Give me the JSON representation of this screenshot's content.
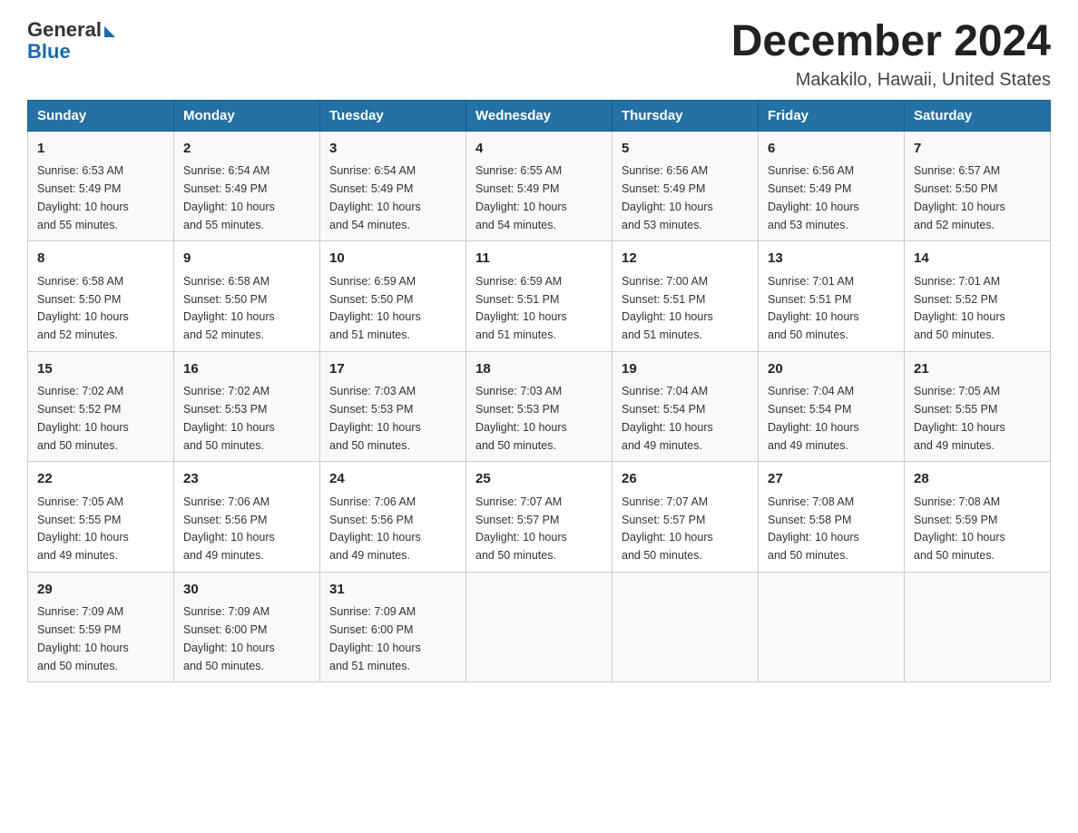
{
  "logo": {
    "general": "General",
    "blue": "Blue"
  },
  "title": "December 2024",
  "location": "Makakilo, Hawaii, United States",
  "days_of_week": [
    "Sunday",
    "Monday",
    "Tuesday",
    "Wednesday",
    "Thursday",
    "Friday",
    "Saturday"
  ],
  "weeks": [
    [
      {
        "day": "1",
        "sunrise": "6:53 AM",
        "sunset": "5:49 PM",
        "daylight": "10 hours and 55 minutes."
      },
      {
        "day": "2",
        "sunrise": "6:54 AM",
        "sunset": "5:49 PM",
        "daylight": "10 hours and 55 minutes."
      },
      {
        "day": "3",
        "sunrise": "6:54 AM",
        "sunset": "5:49 PM",
        "daylight": "10 hours and 54 minutes."
      },
      {
        "day": "4",
        "sunrise": "6:55 AM",
        "sunset": "5:49 PM",
        "daylight": "10 hours and 54 minutes."
      },
      {
        "day": "5",
        "sunrise": "6:56 AM",
        "sunset": "5:49 PM",
        "daylight": "10 hours and 53 minutes."
      },
      {
        "day": "6",
        "sunrise": "6:56 AM",
        "sunset": "5:49 PM",
        "daylight": "10 hours and 53 minutes."
      },
      {
        "day": "7",
        "sunrise": "6:57 AM",
        "sunset": "5:50 PM",
        "daylight": "10 hours and 52 minutes."
      }
    ],
    [
      {
        "day": "8",
        "sunrise": "6:58 AM",
        "sunset": "5:50 PM",
        "daylight": "10 hours and 52 minutes."
      },
      {
        "day": "9",
        "sunrise": "6:58 AM",
        "sunset": "5:50 PM",
        "daylight": "10 hours and 52 minutes."
      },
      {
        "day": "10",
        "sunrise": "6:59 AM",
        "sunset": "5:50 PM",
        "daylight": "10 hours and 51 minutes."
      },
      {
        "day": "11",
        "sunrise": "6:59 AM",
        "sunset": "5:51 PM",
        "daylight": "10 hours and 51 minutes."
      },
      {
        "day": "12",
        "sunrise": "7:00 AM",
        "sunset": "5:51 PM",
        "daylight": "10 hours and 51 minutes."
      },
      {
        "day": "13",
        "sunrise": "7:01 AM",
        "sunset": "5:51 PM",
        "daylight": "10 hours and 50 minutes."
      },
      {
        "day": "14",
        "sunrise": "7:01 AM",
        "sunset": "5:52 PM",
        "daylight": "10 hours and 50 minutes."
      }
    ],
    [
      {
        "day": "15",
        "sunrise": "7:02 AM",
        "sunset": "5:52 PM",
        "daylight": "10 hours and 50 minutes."
      },
      {
        "day": "16",
        "sunrise": "7:02 AM",
        "sunset": "5:53 PM",
        "daylight": "10 hours and 50 minutes."
      },
      {
        "day": "17",
        "sunrise": "7:03 AM",
        "sunset": "5:53 PM",
        "daylight": "10 hours and 50 minutes."
      },
      {
        "day": "18",
        "sunrise": "7:03 AM",
        "sunset": "5:53 PM",
        "daylight": "10 hours and 50 minutes."
      },
      {
        "day": "19",
        "sunrise": "7:04 AM",
        "sunset": "5:54 PM",
        "daylight": "10 hours and 49 minutes."
      },
      {
        "day": "20",
        "sunrise": "7:04 AM",
        "sunset": "5:54 PM",
        "daylight": "10 hours and 49 minutes."
      },
      {
        "day": "21",
        "sunrise": "7:05 AM",
        "sunset": "5:55 PM",
        "daylight": "10 hours and 49 minutes."
      }
    ],
    [
      {
        "day": "22",
        "sunrise": "7:05 AM",
        "sunset": "5:55 PM",
        "daylight": "10 hours and 49 minutes."
      },
      {
        "day": "23",
        "sunrise": "7:06 AM",
        "sunset": "5:56 PM",
        "daylight": "10 hours and 49 minutes."
      },
      {
        "day": "24",
        "sunrise": "7:06 AM",
        "sunset": "5:56 PM",
        "daylight": "10 hours and 49 minutes."
      },
      {
        "day": "25",
        "sunrise": "7:07 AM",
        "sunset": "5:57 PM",
        "daylight": "10 hours and 50 minutes."
      },
      {
        "day": "26",
        "sunrise": "7:07 AM",
        "sunset": "5:57 PM",
        "daylight": "10 hours and 50 minutes."
      },
      {
        "day": "27",
        "sunrise": "7:08 AM",
        "sunset": "5:58 PM",
        "daylight": "10 hours and 50 minutes."
      },
      {
        "day": "28",
        "sunrise": "7:08 AM",
        "sunset": "5:59 PM",
        "daylight": "10 hours and 50 minutes."
      }
    ],
    [
      {
        "day": "29",
        "sunrise": "7:09 AM",
        "sunset": "5:59 PM",
        "daylight": "10 hours and 50 minutes."
      },
      {
        "day": "30",
        "sunrise": "7:09 AM",
        "sunset": "6:00 PM",
        "daylight": "10 hours and 50 minutes."
      },
      {
        "day": "31",
        "sunrise": "7:09 AM",
        "sunset": "6:00 PM",
        "daylight": "10 hours and 51 minutes."
      },
      null,
      null,
      null,
      null
    ]
  ],
  "labels": {
    "sunrise": "Sunrise:",
    "sunset": "Sunset:",
    "daylight": "Daylight:"
  }
}
